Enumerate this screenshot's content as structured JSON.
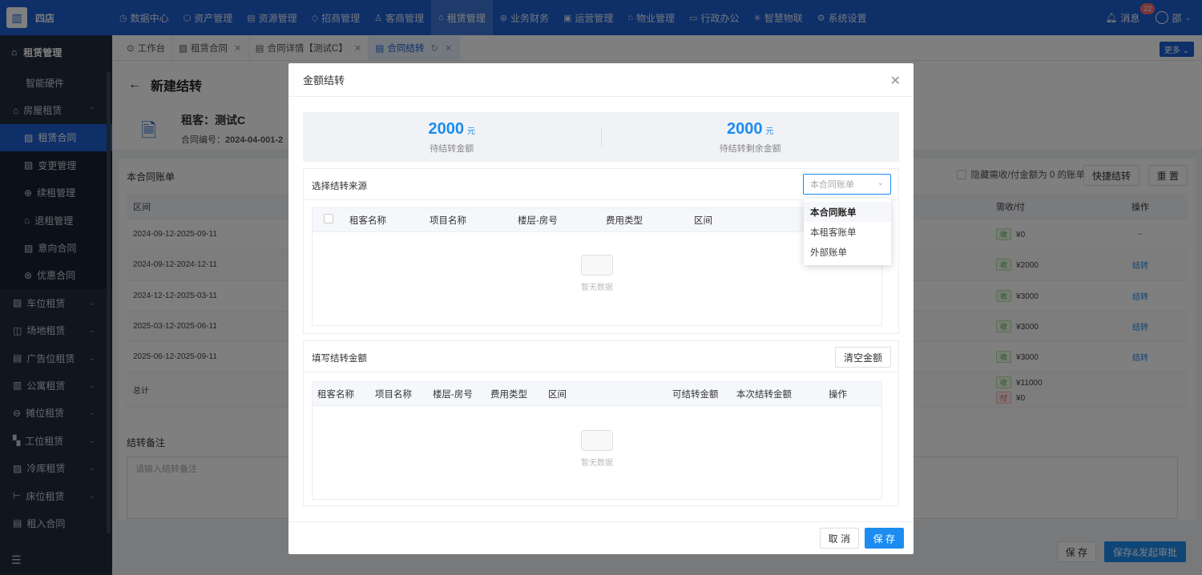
{
  "app": {
    "name": "四店"
  },
  "nav": {
    "items": [
      {
        "icon": "dashboard-icon",
        "glyph": "◷",
        "label": "数据中心"
      },
      {
        "icon": "cube-icon",
        "glyph": "⬡",
        "label": "资产管理"
      },
      {
        "icon": "building-icon",
        "glyph": "▤",
        "label": "资源管理"
      },
      {
        "icon": "tag-icon",
        "glyph": "◇",
        "label": "招商管理"
      },
      {
        "icon": "customer-icon",
        "glyph": "♙",
        "label": "客商管理"
      },
      {
        "icon": "home-icon",
        "glyph": "⌂",
        "label": "租赁管理"
      },
      {
        "icon": "finance-icon",
        "glyph": "⊛",
        "label": "业务财务"
      },
      {
        "icon": "operation-icon",
        "glyph": "▣",
        "label": "运营管理"
      },
      {
        "icon": "property-icon",
        "glyph": "⌂",
        "label": "物业管理"
      },
      {
        "icon": "office-icon",
        "glyph": "▭",
        "label": "行政办公"
      },
      {
        "icon": "iot-icon",
        "glyph": "✳",
        "label": "智慧物联"
      },
      {
        "icon": "settings-icon",
        "glyph": "⚙",
        "label": "系统设置"
      }
    ],
    "message_label": "消息",
    "message_count": "22",
    "user_name": "邵"
  },
  "sidebar": {
    "title": "租赁管理",
    "items": [
      {
        "label": "智能硬件",
        "icon": "",
        "sub": false
      },
      {
        "label": "房屋租赁",
        "icon": "⌂",
        "sub": false,
        "chev": "⌃"
      },
      {
        "label": "租赁合同",
        "icon": "▨",
        "sub": true,
        "active": true
      },
      {
        "label": "变更管理",
        "icon": "▨",
        "sub": true
      },
      {
        "label": "续租管理",
        "icon": "⊕",
        "sub": true
      },
      {
        "label": "退租管理",
        "icon": "⌂",
        "sub": true
      },
      {
        "label": "意向合同",
        "icon": "▨",
        "sub": true
      },
      {
        "label": "优惠合同",
        "icon": "⊛",
        "sub": true
      },
      {
        "label": "车位租赁",
        "icon": "▨",
        "sub": false,
        "chev": "⌄"
      },
      {
        "label": "场地租赁",
        "icon": "◫",
        "sub": false,
        "chev": "⌄"
      },
      {
        "label": "广告位租赁",
        "icon": "▤",
        "sub": false,
        "chev": "⌄"
      },
      {
        "label": "公寓租赁",
        "icon": "▥",
        "sub": false,
        "chev": "⌄"
      },
      {
        "label": "摊位租赁",
        "icon": "⊖",
        "sub": false,
        "chev": "⌄"
      },
      {
        "label": "工位租赁",
        "icon": "▚",
        "sub": false,
        "chev": "⌄"
      },
      {
        "label": "冷库租赁",
        "icon": "▨",
        "sub": false,
        "chev": "⌄"
      },
      {
        "label": "床位租赁",
        "icon": "⊢",
        "sub": false,
        "chev": "⌄"
      },
      {
        "label": "租入合同",
        "icon": "▤",
        "sub": false
      }
    ]
  },
  "tabs": [
    {
      "label": "工作台",
      "icon": "⊙",
      "closable": false
    },
    {
      "label": "租赁合同",
      "icon": "▨",
      "closable": true
    },
    {
      "label": "合同详情【测试C】",
      "icon": "▤",
      "closable": true
    },
    {
      "label": "合同结转",
      "icon": "▤",
      "closable": true,
      "active": true
    }
  ],
  "tabs_more": "更多 ⌄",
  "page": {
    "title": "新建结转",
    "tenant": "租客：测试C",
    "contract_no_label": "合同编号：",
    "contract_no": "2024-04-001-2",
    "bill_section_title": "本合同账单",
    "hide_zero_label": "隐藏需收/付金额为 0 的账单",
    "quick_transfer": "快捷结转",
    "reset": "重 置",
    "bill_headers": {
      "period": "区间",
      "need": "需收/付",
      "op": "操作"
    },
    "bills": [
      {
        "period": "2024-09-12-2025-09-11",
        "tags": [
          {
            "t": "收",
            "v": "¥0"
          }
        ],
        "op": "--"
      },
      {
        "period": "2024-09-12-2024-12-11",
        "tags": [
          {
            "t": "收",
            "v": "¥2000"
          }
        ],
        "op": "结转"
      },
      {
        "period": "2024-12-12-2025-03-11",
        "tags": [
          {
            "t": "收",
            "v": "¥3000"
          }
        ],
        "op": "结转"
      },
      {
        "period": "2025-03-12-2025-06-11",
        "tags": [
          {
            "t": "收",
            "v": "¥3000"
          }
        ],
        "op": "结转"
      },
      {
        "period": "2025-06-12-2025-09-11",
        "tags": [
          {
            "t": "收",
            "v": "¥3000"
          }
        ],
        "op": "结转"
      },
      {
        "period": "总计",
        "tags": [
          {
            "t": "收",
            "v": "¥11000"
          },
          {
            "t": "付",
            "v": "¥0"
          }
        ],
        "op": ""
      }
    ],
    "remark_title": "结转备注",
    "remark_placeholder": "请输入结转备注",
    "save": "保 存",
    "save_submit": "保存&发起审批"
  },
  "modal": {
    "title": "金额结转",
    "pending_amount": "2000",
    "pending_unit": "元",
    "pending_label": "待结转金额",
    "remain_amount": "2000",
    "remain_unit": "元",
    "remain_label": "待结转剩余金额",
    "source_title": "选择结转来源",
    "source_select_placeholder": "本合同账单",
    "source_options": [
      "本合同账单",
      "本租客账单",
      "外部账单"
    ],
    "source_headers": [
      "租客名称",
      "项目名称",
      "楼层-房号",
      "费用类型",
      "区间"
    ],
    "empty_text": "暂无数据",
    "fill_title": "填写结转金额",
    "clear_amount": "清空金额",
    "fill_headers": [
      "租客名称",
      "项目名称",
      "楼层-房号",
      "费用类型",
      "区间",
      "可结转金额",
      "本次结转金额",
      "操作"
    ],
    "cancel": "取 消",
    "save": "保 存"
  }
}
